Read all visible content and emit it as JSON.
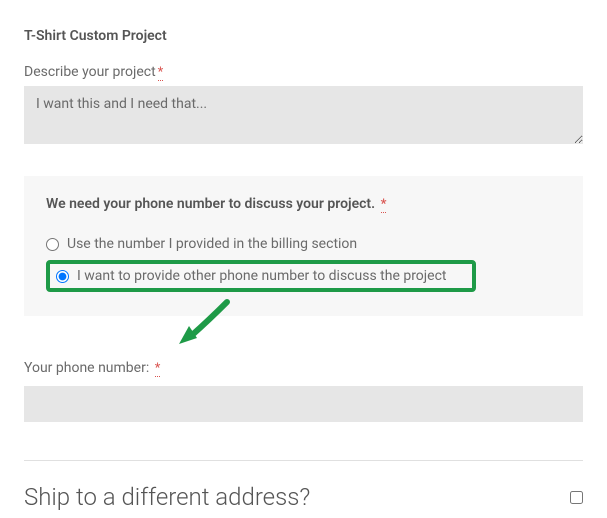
{
  "section_title": "T-Shirt Custom Project",
  "describe": {
    "label": "Describe your project",
    "value": "I want this and I need that...",
    "required": "*"
  },
  "phone_section": {
    "heading": "We need your phone number to discuss your project.",
    "required": "*",
    "options": [
      {
        "label": "Use the number I provided in the billing section",
        "checked": false
      },
      {
        "label": "I want to provide other phone number to discuss the project",
        "checked": true
      }
    ]
  },
  "phone_field": {
    "label": "Your phone number:",
    "required": "*",
    "value": ""
  },
  "ship": {
    "heading": "Ship to a different address?",
    "checked": false
  }
}
